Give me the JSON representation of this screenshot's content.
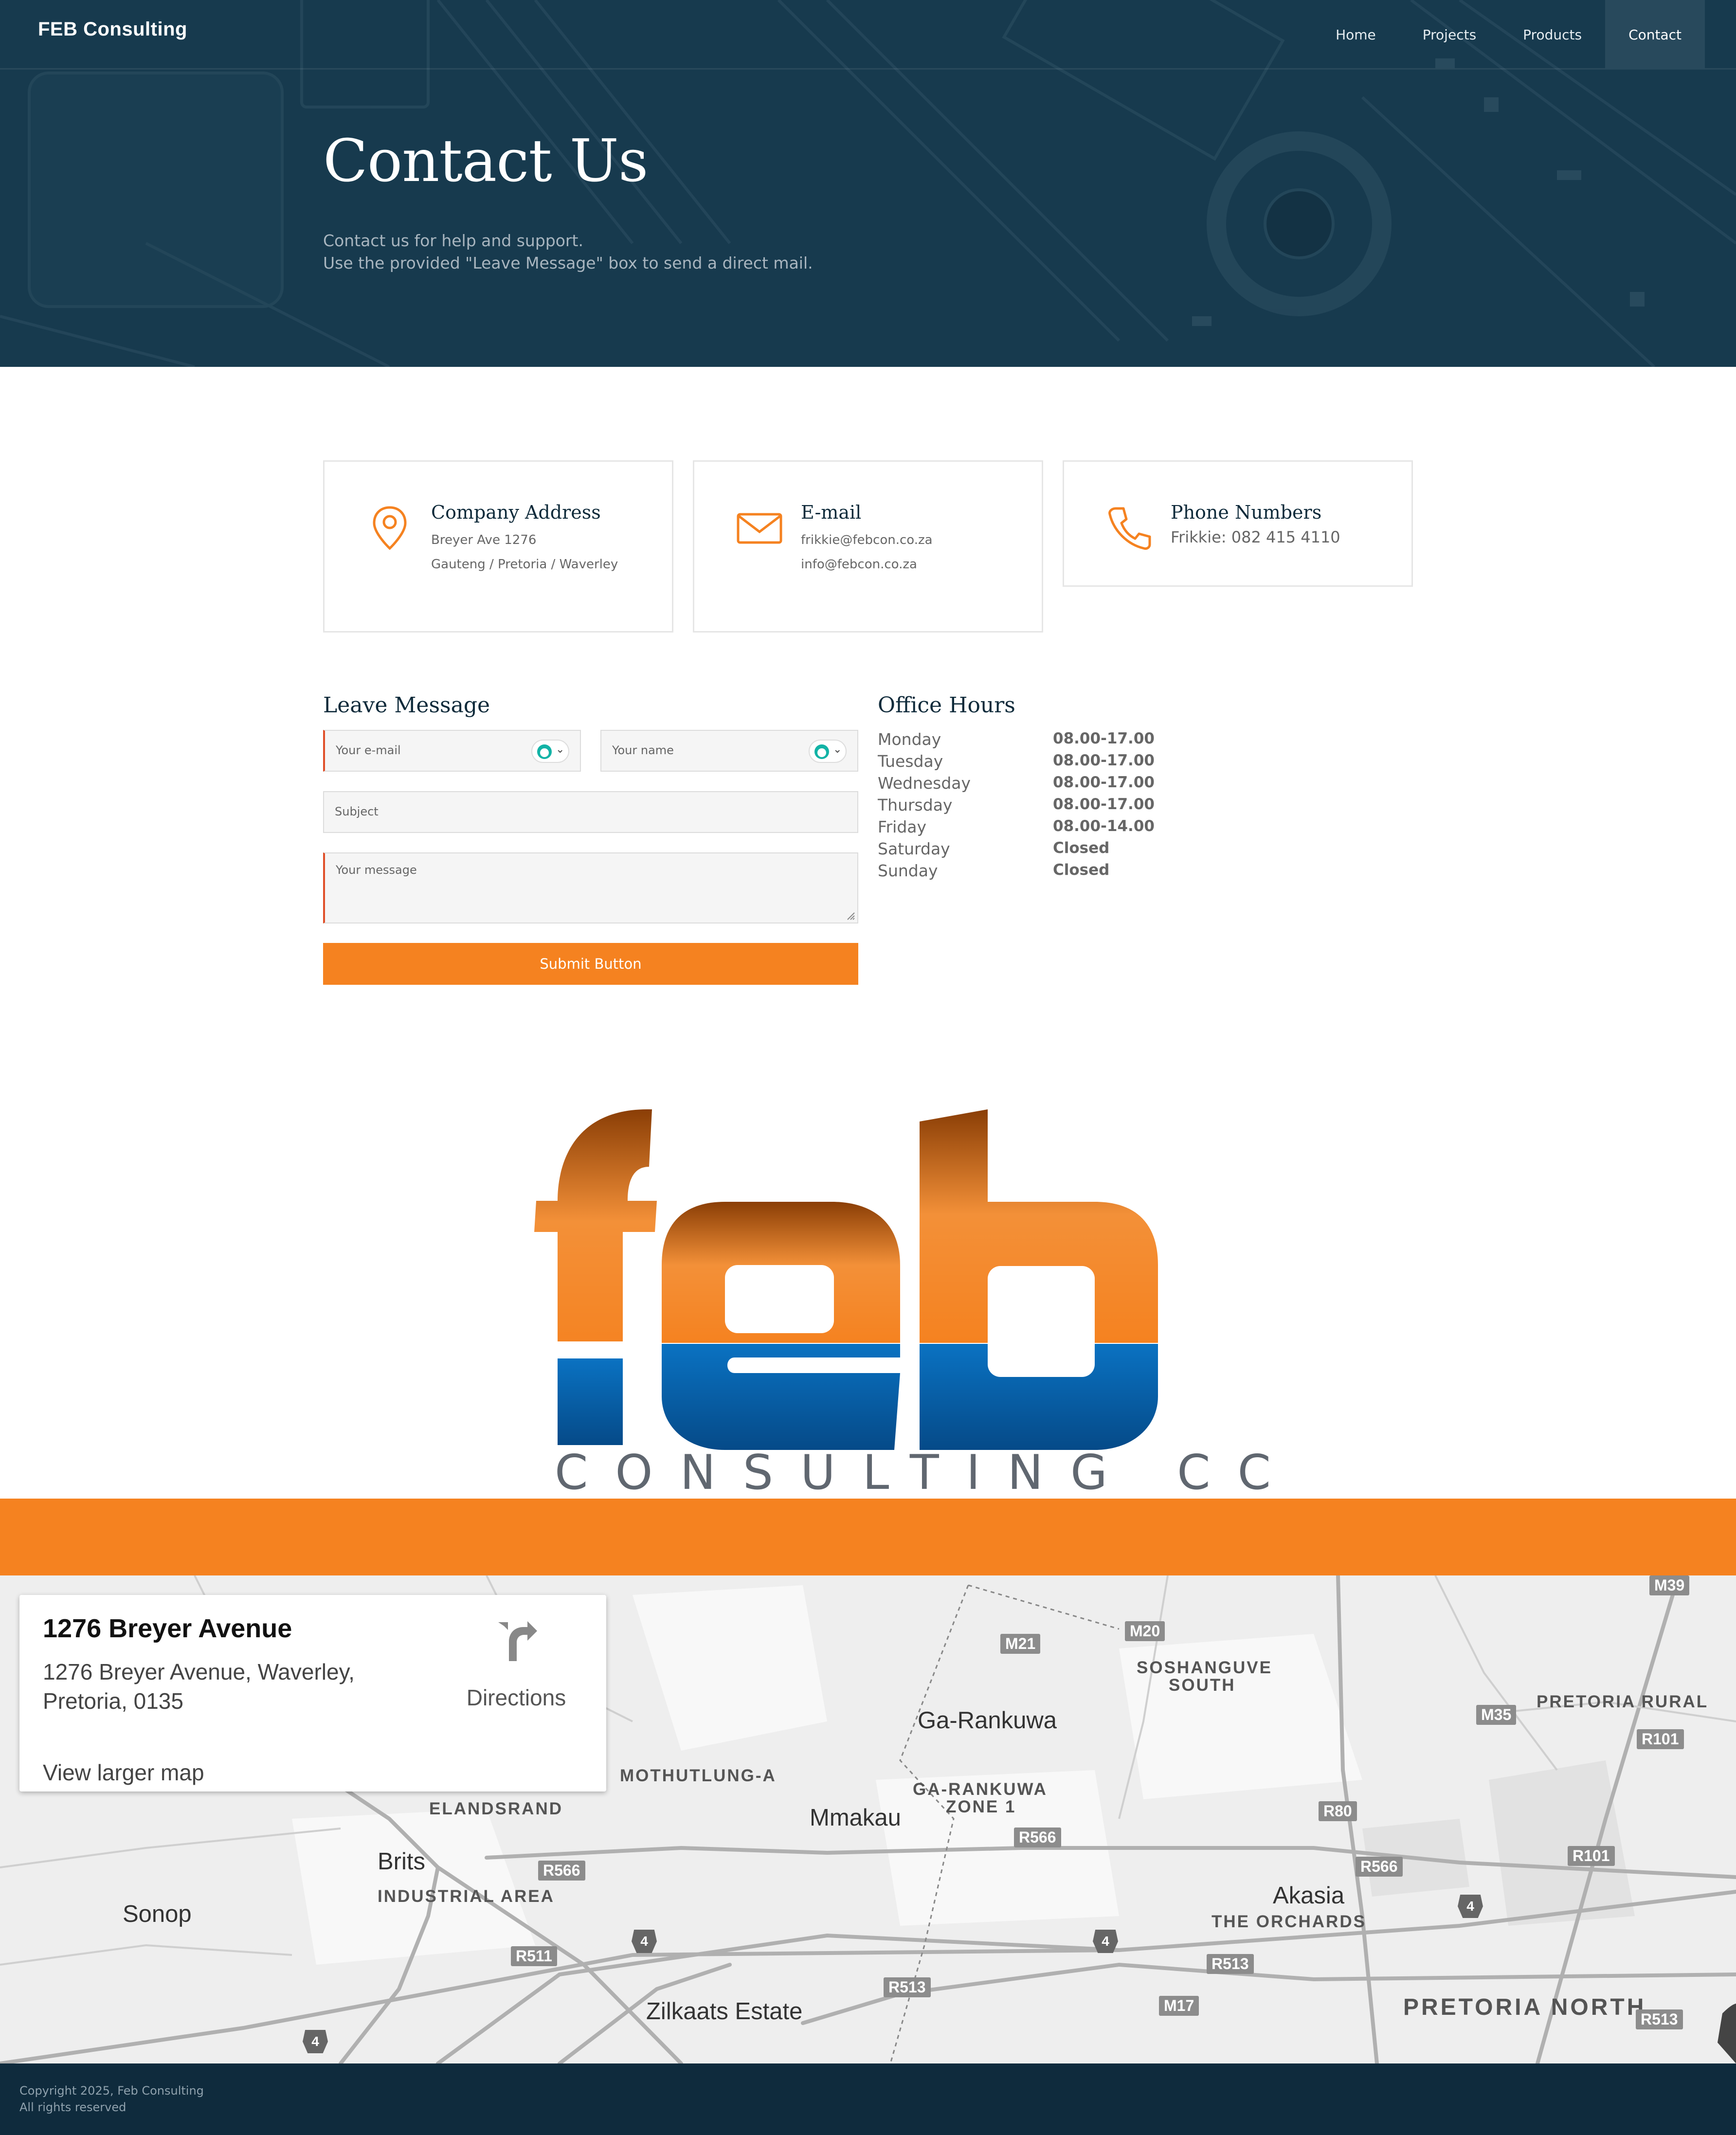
{
  "brand": "FEB Consulting",
  "nav": {
    "items": [
      "Home",
      "Projects",
      "Products",
      "Contact"
    ],
    "active": "Contact"
  },
  "hero": {
    "title": "Contact Us",
    "line1": "Contact us for help and support.",
    "line2": "Use the provided \"Leave Message\" box to send a direct mail."
  },
  "cards": {
    "address": {
      "title": "Company Address",
      "line1": "Breyer Ave 1276",
      "line2": "Gauteng / Pretoria / Waverley",
      "icon": "map-pin-icon"
    },
    "email": {
      "title": "E-mail",
      "line1": "frikkie@febcon.co.za",
      "line2": "info@febcon.co.za",
      "icon": "envelope-icon"
    },
    "phone": {
      "title": "Phone Numbers",
      "line1": "Frikkie: 082 415 4110",
      "icon": "phone-icon"
    }
  },
  "form": {
    "heading": "Leave Message",
    "email_placeholder": "Your e-mail",
    "name_placeholder": "Your name",
    "subject_placeholder": "Subject",
    "message_placeholder": "Your message",
    "submit_label": "Submit Button"
  },
  "hours": {
    "heading": "Office Hours",
    "rows": [
      {
        "day": "Monday",
        "time": "08.00-17.00"
      },
      {
        "day": "Tuesday",
        "time": "08.00-17.00"
      },
      {
        "day": "Wednesday",
        "time": "08.00-17.00"
      },
      {
        "day": "Thursday",
        "time": "08.00-17.00"
      },
      {
        "day": "Friday",
        "time": "08.00-14.00"
      },
      {
        "day": "Saturday",
        "time": "Closed"
      },
      {
        "day": "Sunday",
        "time": "Closed"
      }
    ]
  },
  "logo": {
    "text": "feb",
    "tagline": "CONSULTING CC"
  },
  "map": {
    "place_title": "1276 Breyer Avenue",
    "place_address_1": "1276 Breyer Avenue, Waverley,",
    "place_address_2": "Pretoria, 0135",
    "directions_label": "Directions",
    "larger_map_label": "View larger map",
    "labels": {
      "ga_rankuwa": "Ga-Rankuwa",
      "soshanguve_south_1": "SOSHANGUVE",
      "soshanguve_south_2": "SOUTH",
      "pretoria_rural": "PRETORIA RURAL",
      "mothutlung": "MOTHUTLUNG-A",
      "gr_zone_1": "GA-RANKUWA",
      "gr_zone_2": "ZONE 1",
      "mmakau": "Mmakau",
      "elandsrand": "ELANDSRAND",
      "brits": "Brits",
      "industrial": "INDUSTRIAL AREA",
      "sonop": "Sonop",
      "akasia": "Akasia",
      "orchards": "THE ORCHARDS",
      "zilkaats": "Zilkaats Estate",
      "pretoria_north": "PRETORIA NORTH"
    },
    "shields": {
      "m39": "M39",
      "m20": "M20",
      "m21": "M21",
      "m35": "M35",
      "r101a": "R101",
      "r80": "R80",
      "r566a": "R566",
      "r566b": "R566",
      "r566c": "R566",
      "r101b": "R101",
      "r511": "R511",
      "r513a": "R513",
      "r513b": "R513",
      "r513c": "R513",
      "m17": "M17",
      "n4a": "4",
      "n4b": "4",
      "n4c": "4",
      "n4d": "4"
    }
  },
  "footer": {
    "line1": "Copyright 2025, Feb Consulting",
    "line2": "All rights reserved"
  },
  "colors": {
    "accent": "#f58220",
    "dark": "#0f2b3d",
    "hero": "#173a4e",
    "logo_blue": "#0a66b0"
  }
}
